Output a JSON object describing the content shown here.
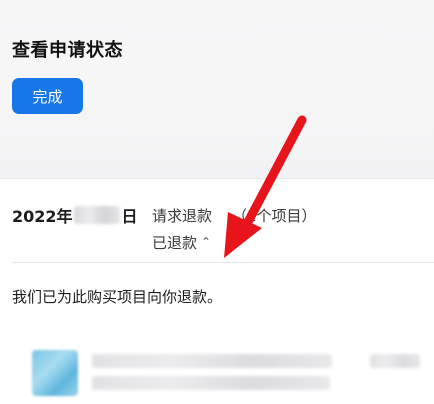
{
  "header": {
    "title": "查看申请状态",
    "done_label": "完成"
  },
  "refund": {
    "date_prefix": "2022年",
    "date_suffix": "日",
    "request_label": "请求退款",
    "items_label": "（1个项目）",
    "status_label": "已退款",
    "chevron_glyph": "⌃"
  },
  "message": "我们已为此购买项目向你退款。",
  "colors": {
    "accent": "#1877e8",
    "arrow": "#e8141b"
  },
  "icons": {
    "chevron": "chevron-up-icon",
    "annotation": "red-arrow-icon"
  }
}
